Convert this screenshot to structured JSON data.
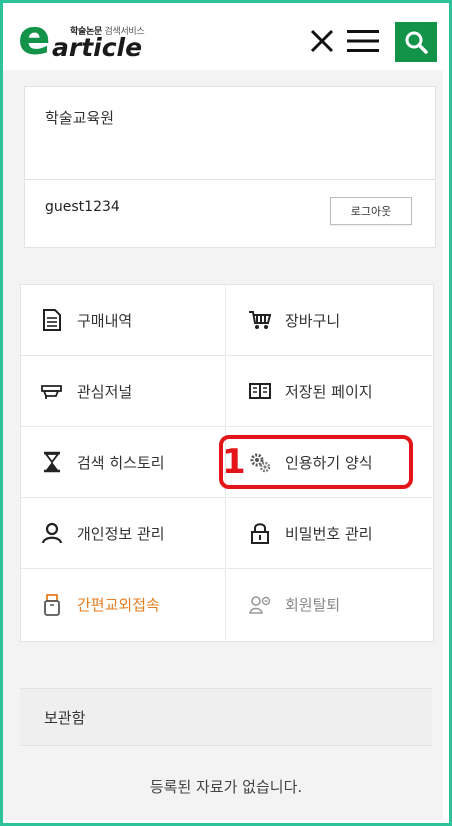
{
  "header": {
    "logo_letter": "e",
    "logo_word": "article",
    "logo_subtitle_bold": "학술논문",
    "logo_subtitle_rest": " 검색서비스",
    "close_icon": "close-icon",
    "menu_icon": "hamburger-menu-icon",
    "search_icon": "search-icon",
    "accent_color": "#13924a",
    "frame_color": "#2ec29a"
  },
  "user_panel": {
    "organization": "학술교육원",
    "username": "guest1234",
    "logout_label": "로그아웃"
  },
  "menu": {
    "items": [
      {
        "label": "구매내역",
        "icon": "document-icon"
      },
      {
        "label": "장바구니",
        "icon": "cart-icon"
      },
      {
        "label": "관심저널",
        "icon": "folder-icon"
      },
      {
        "label": "저장된 페이지",
        "icon": "book-icon"
      },
      {
        "label": "검색 히스토리",
        "icon": "hourglass-icon"
      },
      {
        "label": "인용하기 양식",
        "icon": "gears-icon"
      },
      {
        "label": "개인정보 관리",
        "icon": "person-icon"
      },
      {
        "label": "비밀번호 관리",
        "icon": "lock-icon"
      },
      {
        "label": "간편교외접속",
        "icon": "usb-icon"
      },
      {
        "label": "회원탈퇴",
        "icon": "user-remove-icon"
      }
    ],
    "highlight_number": "1",
    "highlight_color": "#e3151a",
    "orange_color": "#e67e22"
  },
  "saved": {
    "title": "보관함",
    "empty_message": "등록된 자료가 없습니다."
  }
}
